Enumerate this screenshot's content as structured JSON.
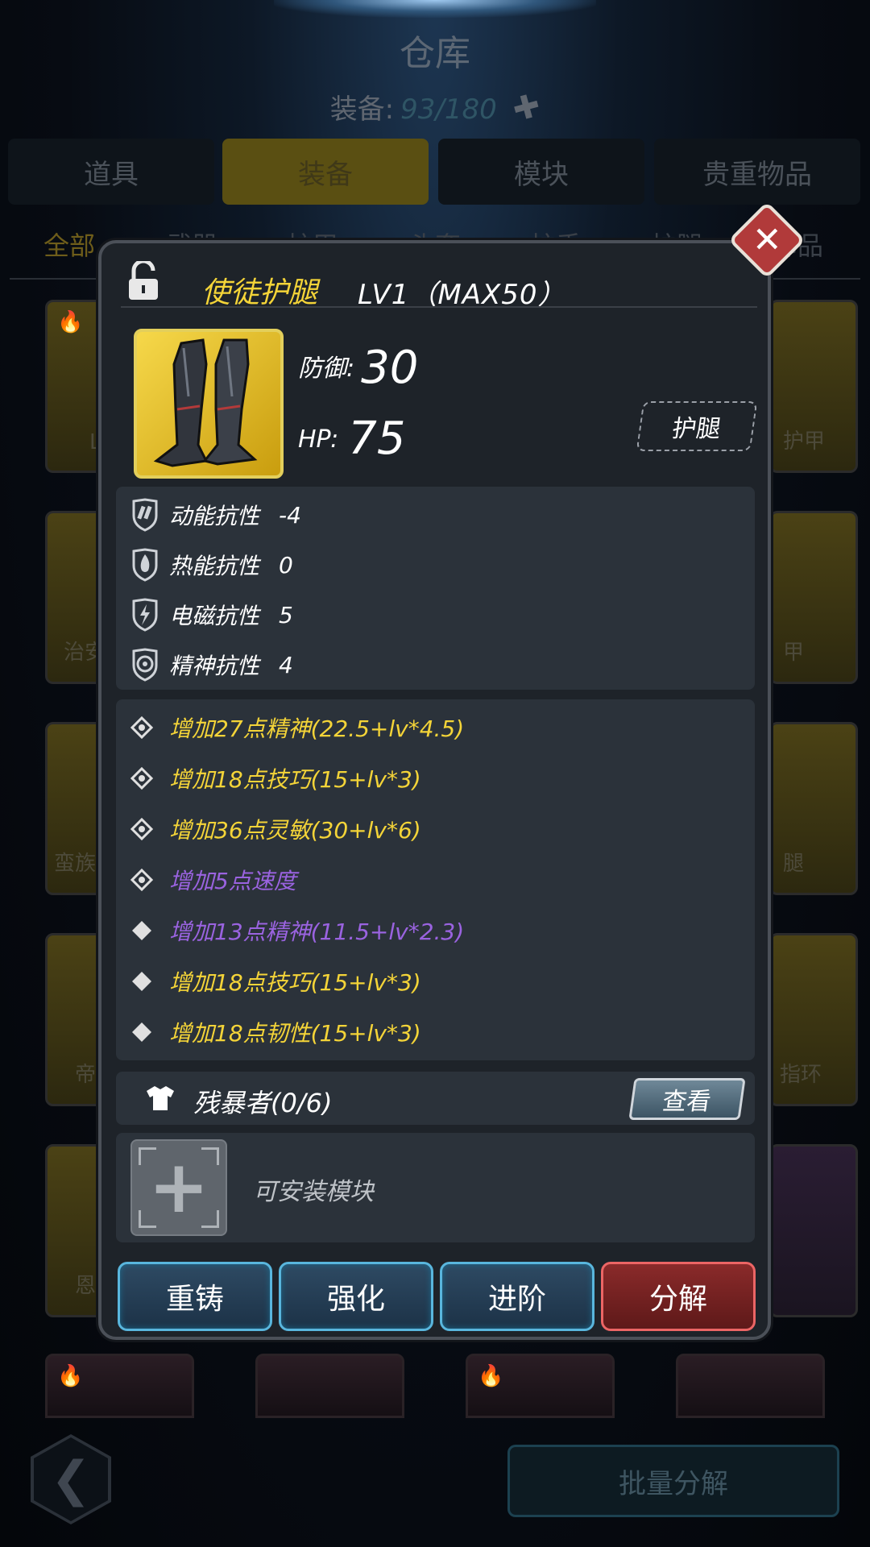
{
  "header": {
    "title": "仓库",
    "capacity_label": "装备:",
    "capacity_value": "93/180"
  },
  "tabs": [
    "道具",
    "装备",
    "模块",
    "贵重物品"
  ],
  "active_tab": "装备",
  "subtabs": [
    "全部",
    "武器",
    "护甲",
    "头套",
    "护手",
    "护腿",
    "饰品"
  ],
  "background_card_labels": {
    "left": [
      "L",
      "治安",
      "蛮族",
      "帝",
      "恩"
    ],
    "right": [
      "护甲",
      "甲",
      "腿",
      "指环"
    ]
  },
  "bottom_bar": {
    "batch_label": "批量分解"
  },
  "item": {
    "name": "使徒护腿",
    "level": "LV1（MAX50）",
    "type_tag": "护腿",
    "stats": [
      {
        "label": "防御:",
        "value": "30"
      },
      {
        "label": "HP:",
        "value": "75"
      }
    ],
    "resistances": [
      {
        "label": "动能抗性",
        "value": "-4",
        "icon": "kinetic-resist-icon"
      },
      {
        "label": "热能抗性",
        "value": "0",
        "icon": "thermal-resist-icon"
      },
      {
        "label": "电磁抗性",
        "value": "5",
        "icon": "electromagnetic-resist-icon"
      },
      {
        "label": "精神抗性",
        "value": "4",
        "icon": "psychic-resist-icon"
      }
    ],
    "affixes": [
      {
        "text": "增加27点精神(22.5+lv*4.5)",
        "color": "gold",
        "locked": true
      },
      {
        "text": "增加18点技巧(15+lv*3)",
        "color": "gold",
        "locked": true
      },
      {
        "text": "增加36点灵敏(30+lv*6)",
        "color": "gold",
        "locked": true
      },
      {
        "text": "增加5点速度",
        "color": "purple",
        "locked": true
      },
      {
        "text": "增加13点精神(11.5+lv*2.3)",
        "color": "purple",
        "locked": false
      },
      {
        "text": "增加18点技巧(15+lv*3)",
        "color": "gold",
        "locked": false
      },
      {
        "text": "增加18点韧性(15+lv*3)",
        "color": "gold",
        "locked": false
      }
    ],
    "set": {
      "name": "残暴者(0/6)",
      "view_label": "查看"
    },
    "module_slot_label": "可安装模块"
  },
  "actions": [
    {
      "label": "重铸",
      "style": "blue"
    },
    {
      "label": "强化",
      "style": "blue"
    },
    {
      "label": "进阶",
      "style": "blue"
    },
    {
      "label": "分解",
      "style": "red"
    }
  ],
  "colors": {
    "gold_text": "#f4d438",
    "purple_text": "#9a63e0",
    "portrait_bg": "#f6d84a",
    "action_blue_border": "#59b6dd",
    "action_red_bg": "#8a2a2a",
    "close_red": "#b13a3a"
  }
}
